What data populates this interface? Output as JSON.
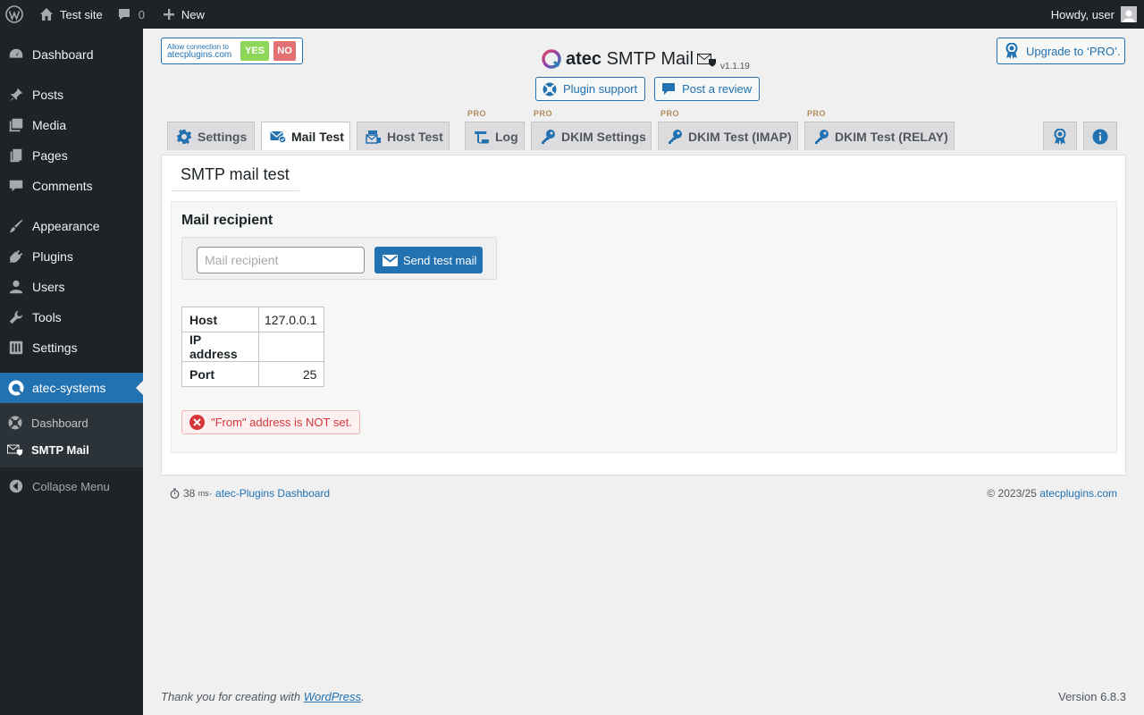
{
  "admin_bar": {
    "site_name": "Test site",
    "comments_count": "0",
    "new_label": "New",
    "howdy": "Howdy, user"
  },
  "sidebar": {
    "items": [
      {
        "label": "Dashboard",
        "icon": "dashboard-icon"
      },
      {
        "label": "Posts",
        "icon": "pin-icon"
      },
      {
        "label": "Media",
        "icon": "media-icon"
      },
      {
        "label": "Pages",
        "icon": "pages-icon"
      },
      {
        "label": "Comments",
        "icon": "comment-icon"
      },
      {
        "label": "Appearance",
        "icon": "brush-icon"
      },
      {
        "label": "Plugins",
        "icon": "plug-icon"
      },
      {
        "label": "Users",
        "icon": "user-icon"
      },
      {
        "label": "Tools",
        "icon": "wrench-icon"
      },
      {
        "label": "Settings",
        "icon": "settings-icon"
      },
      {
        "label": "atec-systems",
        "icon": "atec-logo-icon"
      }
    ],
    "submenu": [
      {
        "label": "Dashboard"
      },
      {
        "label": "SMTP Mail"
      }
    ],
    "collapse_label": "Collapse Menu"
  },
  "header": {
    "consent_line1": "Allow connection to",
    "consent_line2": "atecplugins.com",
    "consent_yes": "YES",
    "consent_no": "NO",
    "brand_bold": "atec",
    "brand_rest": "SMTP Mail",
    "version": "v1.1.19",
    "plugin_support": "Plugin support",
    "post_review": "Post a review",
    "upgrade": "Upgrade to ‘PRO’."
  },
  "tabs": [
    {
      "label": "Settings",
      "pro": ""
    },
    {
      "label": "Mail Test",
      "pro": ""
    },
    {
      "label": "Host Test",
      "pro": ""
    },
    {
      "label": "Log",
      "pro": "PRO"
    },
    {
      "label": "DKIM Settings",
      "pro": "PRO"
    },
    {
      "label": "DKIM Test (IMAP)",
      "pro": "PRO"
    },
    {
      "label": "DKIM Test (RELAY)",
      "pro": "PRO"
    }
  ],
  "active_tab": "Mail Test",
  "panel": {
    "title": "SMTP mail test",
    "section_title": "Mail recipient",
    "recipient_placeholder": "Mail recipient",
    "recipient_value": "",
    "send_button": "Send test mail",
    "info_table": [
      {
        "key": "Host",
        "value": "127.0.0.1"
      },
      {
        "key": "IP address",
        "value": ""
      },
      {
        "key": "Port",
        "value": "25"
      }
    ],
    "error_notice": "\"From\" address is NOT set."
  },
  "page_footer": {
    "ms_value": "38",
    "ms_unit": "ms",
    "dashboard_link": "· atec-Plugins Dashboard",
    "copyright": "© 2023/25",
    "copyright_link": "atecplugins.com"
  },
  "wp_footer": {
    "thanks_prefix": "Thank you for creating with",
    "wp_link": "WordPress",
    "thanks_suffix": ".",
    "version": "Version 6.8.3"
  },
  "colors": {
    "accent": "#2271b1",
    "sidebar_bg": "#1d2327",
    "error": "#d63638",
    "yes": "#7ad03a"
  }
}
